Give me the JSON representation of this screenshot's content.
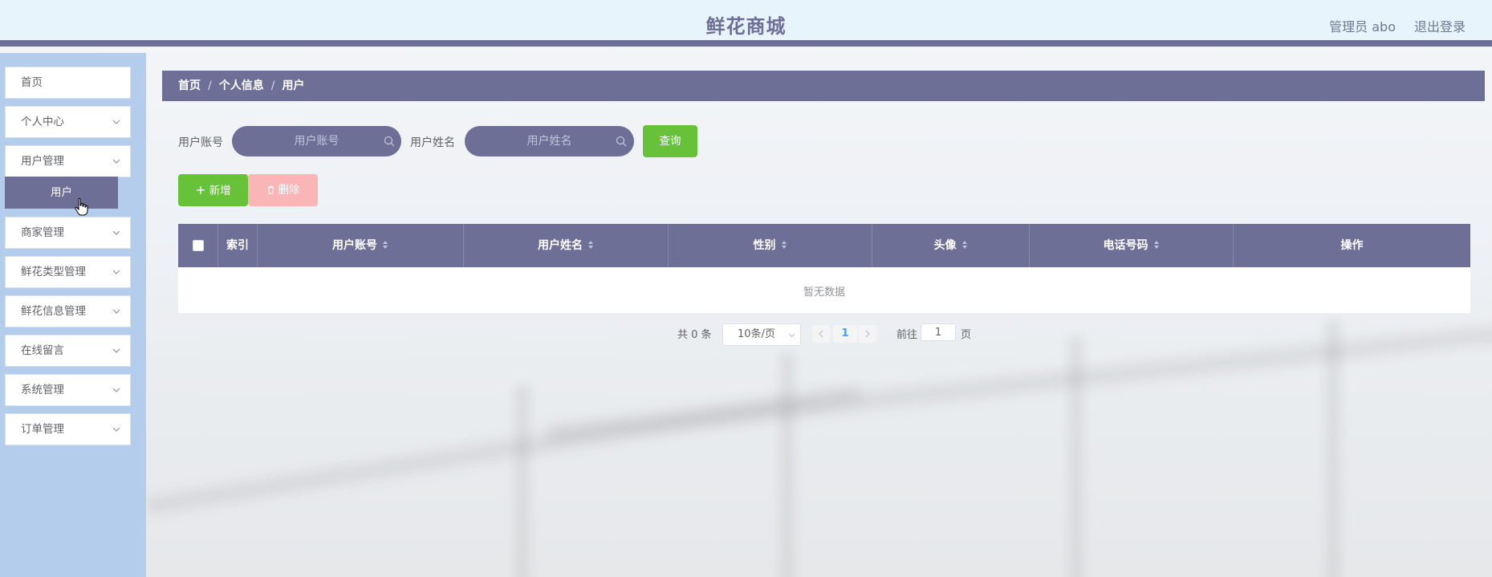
{
  "header": {
    "title": "鲜花商城",
    "user": "管理员 abo",
    "logout": "退出登录"
  },
  "sidebar": {
    "items": [
      {
        "label": "首页",
        "has_arrow": false
      },
      {
        "label": "个人中心",
        "has_arrow": true
      },
      {
        "label": "用户管理",
        "has_arrow": true
      },
      {
        "label": "商家管理",
        "has_arrow": true
      },
      {
        "label": "鲜花类型管理",
        "has_arrow": true
      },
      {
        "label": "鲜花信息管理",
        "has_arrow": true
      },
      {
        "label": "在线留言",
        "has_arrow": true
      },
      {
        "label": "系统管理",
        "has_arrow": true
      },
      {
        "label": "订单管理",
        "has_arrow": true
      }
    ],
    "submenu_active": "用户"
  },
  "breadcrumb": [
    "首页",
    "个人信息",
    "用户"
  ],
  "search": {
    "account_label": "用户账号",
    "account_placeholder": "用户账号",
    "name_label": "用户姓名",
    "name_placeholder": "用户姓名",
    "query_button": "查询"
  },
  "actions": {
    "add": "新增",
    "delete": "删除"
  },
  "table": {
    "columns": [
      "索引",
      "用户账号",
      "用户姓名",
      "性别",
      "头像",
      "电话号码",
      "操作"
    ],
    "empty_text": "暂无数据"
  },
  "pagination": {
    "total": "共 0 条",
    "page_size": "10条/页",
    "current_page": "1",
    "goto_label": "前往",
    "goto_value": "1",
    "page_suffix": "页"
  },
  "colors": {
    "primary": "#6e6f96",
    "success": "#67c23a",
    "danger_disabled": "#fab6b6",
    "sidebar_bg": "#b5cdec",
    "header_bg": "#e8f4fb"
  }
}
